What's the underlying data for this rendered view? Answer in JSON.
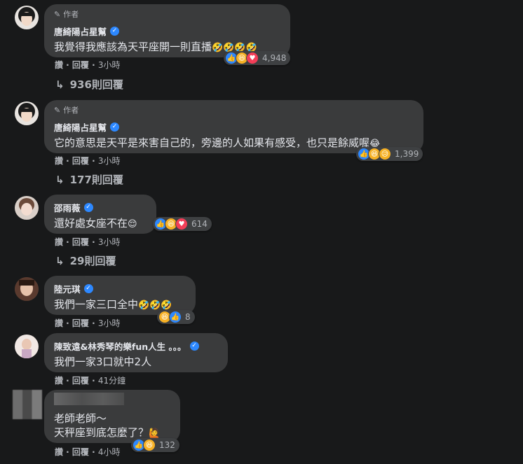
{
  "comments": [
    {
      "author_tag": "作者",
      "name": "唐綺陽占星幫",
      "text": "我覺得我應該為天平座開一則直播",
      "emojis": "🤣🤣🤣🤣",
      "reaction_count": "4,948",
      "actions": "讚 · 回覆 ·",
      "time": "3小時",
      "replies": "936則回覆"
    },
    {
      "author_tag": "作者",
      "name": "唐綺陽占星幫",
      "text": "它的意思是天平是來害自己的，旁邊的人如果有感受，也只是餘威喔",
      "emojis": "😂",
      "reaction_count": "1,399",
      "actions": "讚 · 回覆 ·",
      "time": "3小時",
      "replies": "177則回覆"
    },
    {
      "name": "邵雨薇",
      "text": "還好處女座不在",
      "emojis": "😌",
      "reaction_count": "614",
      "actions": "讚 · 回覆 ·",
      "time": "3小時",
      "replies": "29則回覆"
    },
    {
      "name": "陸元琪",
      "text": "我們一家三口全中",
      "emojis": "🤣🤣🤣",
      "reaction_count": "8",
      "actions": "讚 · 回覆 ·",
      "time": "3小時"
    },
    {
      "name": "陳致遠&林秀琴的樂fun人生 。。。",
      "text": "我們一家3口就中2人",
      "actions": "讚 · 回覆 ·",
      "time": "41分鐘"
    },
    {
      "text_line1": "老師老師～",
      "text_line2": "天秤座到底怎麼了？",
      "emojis": "🙋",
      "reaction_count": "132",
      "actions": "讚 · 回覆 ·",
      "time": "4小時"
    }
  ],
  "icons": {
    "pencil": "✎",
    "reply_arrow": "↳",
    "verified": "✓",
    "like": "👍",
    "haha": "😆",
    "love": "♥",
    "sad": "😥"
  }
}
